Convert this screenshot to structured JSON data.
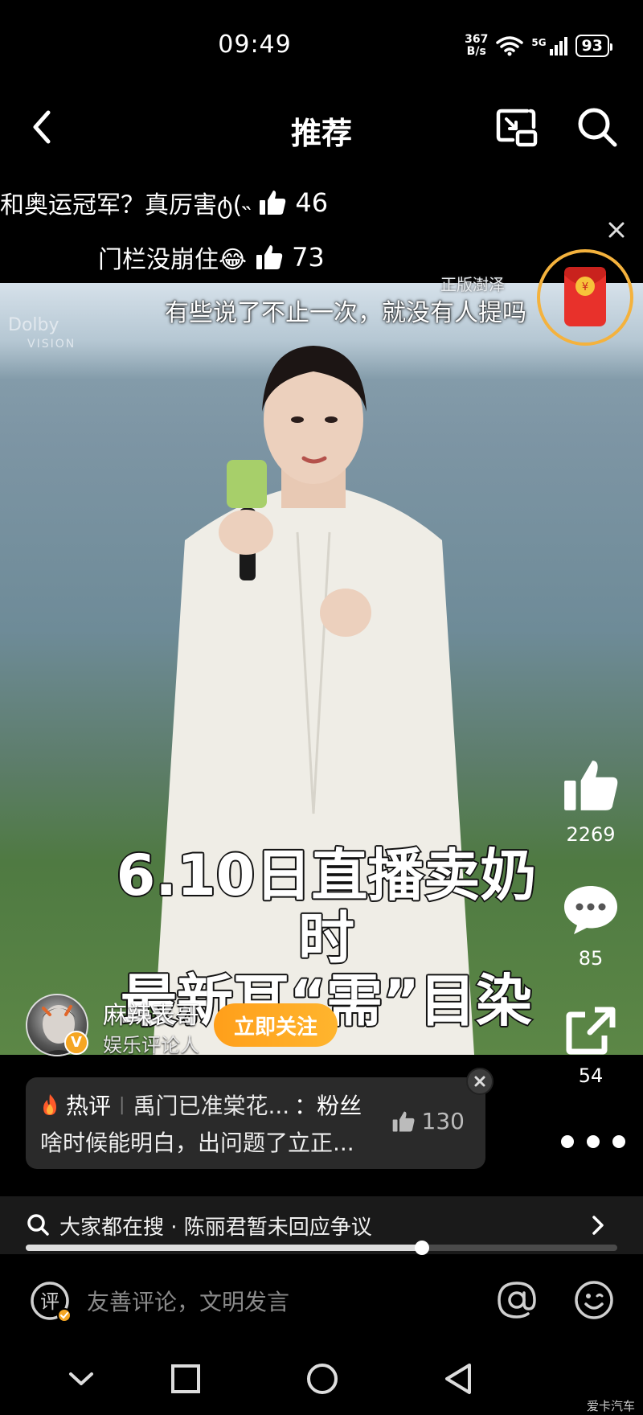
{
  "status_bar": {
    "time": "09:49",
    "net_speed_value": "367",
    "net_speed_unit": "B/s",
    "network": "5G",
    "battery": "93"
  },
  "header": {
    "title": "推荐"
  },
  "danmaku": [
    {
      "text": "和奥运冠军？真厉害ტ(˵",
      "likes": "46"
    },
    {
      "text": "门栏没崩住😂",
      "likes": "73"
    }
  ],
  "video": {
    "top_caption": "有些说了不止一次，就没有人提吗",
    "watermark_brand": "正版澍泽",
    "dolby": "Dolby",
    "dolby_sub": "VISION",
    "big_caption_line1": "6.10日直播卖奶时",
    "big_caption_line2": "最新耳“需”目染"
  },
  "author": {
    "name": "麻辣表哥",
    "role": "娱乐评论人",
    "follow_label": "立即关注"
  },
  "actions": {
    "likes": "2269",
    "comments": "85",
    "shares": "54"
  },
  "hot_comment": {
    "tag": "热评",
    "user": "禹门已准棠花...",
    "text_prefix": "：粉丝",
    "text_line2": "啥时候能明白，出问题了立正...",
    "likes": "130"
  },
  "search": {
    "text": "大家都在搜 · 陈丽君暂未回应争议"
  },
  "playback": {
    "progress": 0.67
  },
  "comment_bar": {
    "placeholder": "友善评论，文明发言",
    "icon_char": "评"
  },
  "corner_watermark": "爱卡汽车",
  "colors": {
    "accent_orange": "#ff9f1a",
    "redpacket_ring": "#f4b23d",
    "redpacket_red": "#e8312b"
  }
}
